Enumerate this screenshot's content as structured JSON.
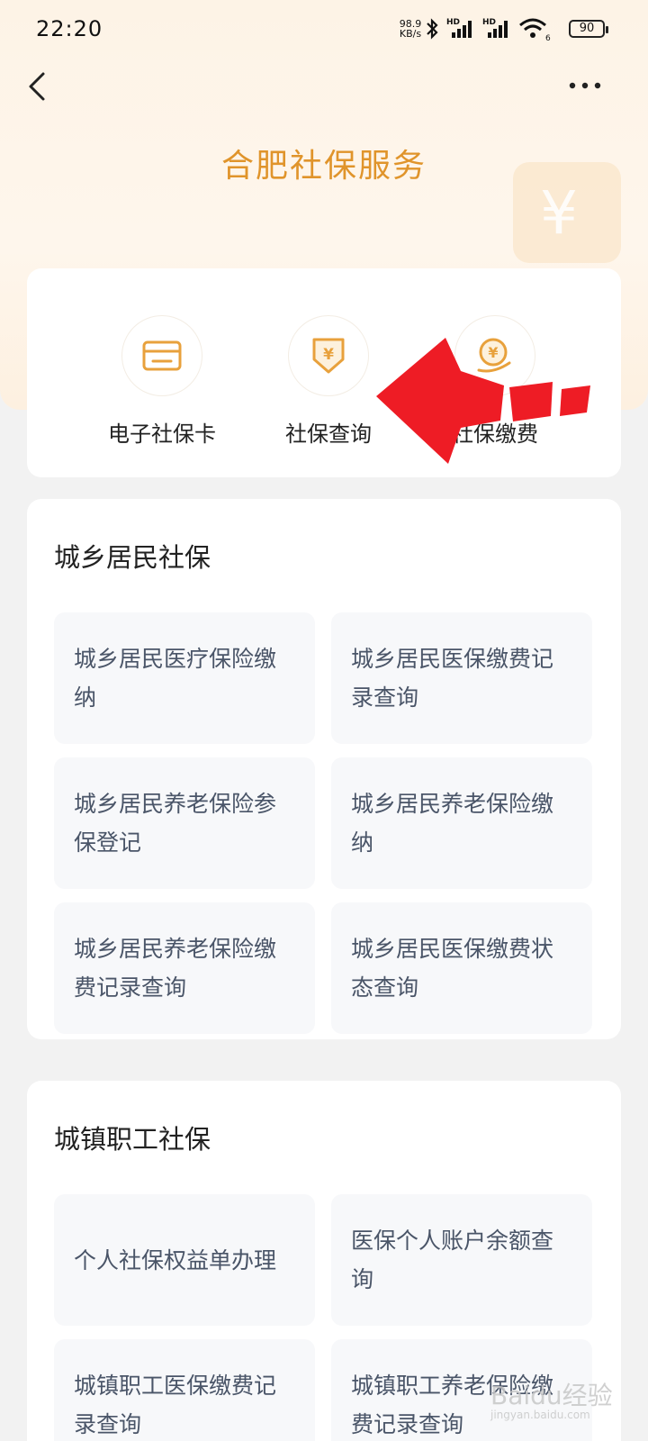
{
  "status_bar": {
    "time": "22:20",
    "net_speed_value": "98.9",
    "net_speed_unit": "KB/s",
    "hd1": "HD",
    "hd2": "HD",
    "wifi_badge": "6",
    "battery": "90"
  },
  "header": {
    "title": "合肥社保服务",
    "deco_symbol": "¥"
  },
  "quick_actions": [
    {
      "label": "电子社保卡",
      "icon": "card-icon"
    },
    {
      "label": "社保查询",
      "icon": "shield-yen-icon"
    },
    {
      "label": "社保缴费",
      "icon": "coin-hand-icon"
    }
  ],
  "sections": [
    {
      "title": "城乡居民社保",
      "items": [
        {
          "line1": "城乡居民医疗保险缴",
          "line2": "纳"
        },
        {
          "line1": "城乡居民医保缴费记",
          "line2": "录查询"
        },
        {
          "line1": "城乡居民养老保险参",
          "line2": "保登记"
        },
        {
          "line1": "城乡居民养老保险缴",
          "line2": "纳"
        },
        {
          "line1": "城乡居民养老保险缴",
          "line2": "费记录查询"
        },
        {
          "line1": "城乡居民医保缴费状",
          "line2": "态查询"
        }
      ]
    },
    {
      "title": "城镇职工社保",
      "items": [
        {
          "line1": "个人社保权益单办理",
          "line2": ""
        },
        {
          "line1": "医保个人账户余额查",
          "line2": "询"
        },
        {
          "line1": "城镇职工医保缴费记",
          "line2": "录查询"
        },
        {
          "line1": "城镇职工养老保险缴",
          "line2": "费记录查询"
        }
      ]
    }
  ],
  "watermark": {
    "text": "Baidu经验",
    "sub": "jingyan.baidu.com"
  },
  "colors": {
    "accent": "#e0942b",
    "arrow": "#ee1c25",
    "tile_bg": "#f7f8fa"
  }
}
